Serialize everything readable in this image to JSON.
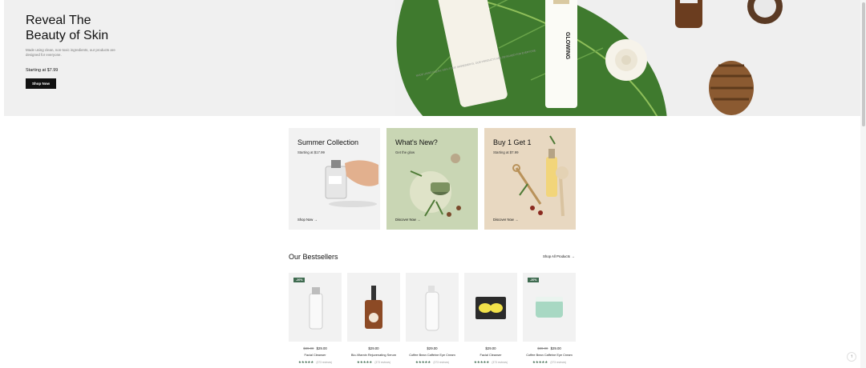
{
  "hero": {
    "title_line1": "Reveal The",
    "title_line2": "Beauty of Skin",
    "subtitle": "Made using clean, non-toxic ingredients, our products are designed for everyone.",
    "price": "Starting at $7.99",
    "button": "Shop Now",
    "tube_text": "MADE USING CLEAN, NON-TOXIC INGREDIENTS, OUR PRODUCTS ARE DESIGNED FOR EVERYONE.",
    "bottle_label": "GLOWING"
  },
  "collections": [
    {
      "title": "Summer Collection",
      "subtitle": "Starting at $17.99",
      "link": "Shop Now →",
      "bg": "#f2f2f2"
    },
    {
      "title": "What's New?",
      "subtitle": "Get the glow",
      "link": "Discover Now →",
      "bg": "#c9d6b4"
    },
    {
      "title": "Buy 1 Get 1",
      "subtitle": "Starting at $7.99",
      "link": "Discover Now →",
      "bg": "#e8d8c1"
    }
  ],
  "bestsellers": {
    "title": "Our Bestsellers",
    "shop_all": "Shop All Products →",
    "products": [
      {
        "badge": "-20%",
        "old_price": "$39.00",
        "price": "$29.00",
        "name": "Facial Cleanser",
        "stars": "★★★★★",
        "reviews": "(373 reviews)"
      },
      {
        "badge": "",
        "old_price": "",
        "price": "$29.00",
        "name": "Bio-Vitamin Rejuvenating Serum",
        "stars": "★★★★★",
        "reviews": "(373 reviews)"
      },
      {
        "badge": "",
        "old_price": "",
        "price": "$29.00",
        "name": "Coffee Bean Caffeine Eye Cream",
        "stars": "★★★★★",
        "reviews": "(373 reviews)"
      },
      {
        "badge": "",
        "old_price": "",
        "price": "$29.00",
        "name": "Facial Cleanser",
        "stars": "★★★★★",
        "reviews": "(373 reviews)"
      },
      {
        "badge": "-20%",
        "old_price": "$39.00",
        "price": "$29.00",
        "name": "Coffee Bean Caffeine Eye Cream",
        "stars": "★★★★★",
        "reviews": "(373 reviews)"
      }
    ]
  },
  "back_to_top": "↑",
  "colors": {
    "accent": "#3f6b50",
    "dark": "#111111",
    "hero_bg": "#f0f0f0"
  }
}
